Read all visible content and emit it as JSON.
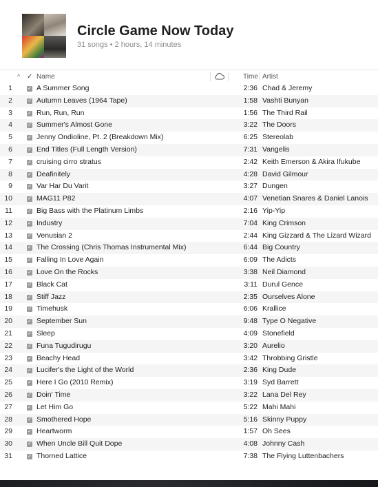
{
  "playlist": {
    "title": "Circle Game Now Today",
    "subtitle": "31 songs • 2 hours, 14 minutes"
  },
  "columns": {
    "sort_indicator": "^",
    "check": "✓",
    "name": "Name",
    "cloud_icon": "cloud-icon",
    "time": "Time",
    "artist": "Artist"
  },
  "tracks": [
    {
      "num": "1",
      "name": "A Summer Song",
      "time": "2:36",
      "artist": "Chad & Jeremy"
    },
    {
      "num": "2",
      "name": "Autumn Leaves (1964 Tape)",
      "time": "1:58",
      "artist": "Vashti Bunyan"
    },
    {
      "num": "3",
      "name": "Run, Run, Run",
      "time": "1:56",
      "artist": "The Third Rail"
    },
    {
      "num": "4",
      "name": "Summer's Almost Gone",
      "time": "3:22",
      "artist": "The Doors"
    },
    {
      "num": "5",
      "name": "Jenny Ondioline, Pt. 2 (Breakdown Mix)",
      "time": "6:25",
      "artist": "Stereolab"
    },
    {
      "num": "6",
      "name": "End Titles (Full Length Version)",
      "time": "7:31",
      "artist": "Vangelis"
    },
    {
      "num": "7",
      "name": "cruising cirro stratus",
      "time": "2:42",
      "artist": "Keith Emerson & Akira Ifukube"
    },
    {
      "num": "8",
      "name": "Deafinitely",
      "time": "4:28",
      "artist": "David Gilmour"
    },
    {
      "num": "9",
      "name": "Var Har Du Varit",
      "time": "3:27",
      "artist": "Dungen"
    },
    {
      "num": "10",
      "name": "MAG11 P82",
      "time": "4:07",
      "artist": "Venetian Snares & Daniel Lanois"
    },
    {
      "num": "11",
      "name": "Big Bass with the Platinum Limbs",
      "time": "2:16",
      "artist": "Yip-Yip"
    },
    {
      "num": "12",
      "name": "Industry",
      "time": "7:04",
      "artist": "King Crimson"
    },
    {
      "num": "13",
      "name": "Venusian 2",
      "time": "2:44",
      "artist": "King Gizzard & The Lizard Wizard"
    },
    {
      "num": "14",
      "name": "The Crossing (Chris Thomas Instrumental Mix)",
      "time": "6:44",
      "artist": "Big Country"
    },
    {
      "num": "15",
      "name": "Falling In Love Again",
      "time": "6:09",
      "artist": "The Adicts"
    },
    {
      "num": "16",
      "name": "Love On the Rocks",
      "time": "3:38",
      "artist": "Neil Diamond"
    },
    {
      "num": "17",
      "name": "Black Cat",
      "time": "3:11",
      "artist": "Durul Gence"
    },
    {
      "num": "18",
      "name": "Stiff Jazz",
      "time": "2:35",
      "artist": "Ourselves Alone"
    },
    {
      "num": "19",
      "name": "Timehusk",
      "time": "6:06",
      "artist": "Krallice"
    },
    {
      "num": "20",
      "name": "September Sun",
      "time": "9:48",
      "artist": "Type O Negative"
    },
    {
      "num": "21",
      "name": "Sleep",
      "time": "4:09",
      "artist": "Stonefield"
    },
    {
      "num": "22",
      "name": "Funa Tugudirugu",
      "time": "3:20",
      "artist": "Aurelio"
    },
    {
      "num": "23",
      "name": "Beachy Head",
      "time": "3:42",
      "artist": "Throbbing Gristle"
    },
    {
      "num": "24",
      "name": "Lucifer's the Light of the World",
      "time": "2:36",
      "artist": "King Dude"
    },
    {
      "num": "25",
      "name": "Here I Go (2010 Remix)",
      "time": "3:19",
      "artist": "Syd Barrett"
    },
    {
      "num": "26",
      "name": "Doin' Time",
      "time": "3:22",
      "artist": "Lana Del Rey"
    },
    {
      "num": "27",
      "name": "Let Him Go",
      "time": "5:22",
      "artist": "Mahi Mahi"
    },
    {
      "num": "28",
      "name": "Smothered Hope",
      "time": "5:16",
      "artist": "Skinny Puppy"
    },
    {
      "num": "29",
      "name": "Heartworm",
      "time": "1:57",
      "artist": "Oh Sees"
    },
    {
      "num": "30",
      "name": "When Uncle Bill Quit Dope",
      "time": "4:08",
      "artist": "Johnny Cash"
    },
    {
      "num": "31",
      "name": "Thorned Lattice",
      "time": "7:38",
      "artist": "The Flying Luttenbachers"
    }
  ]
}
